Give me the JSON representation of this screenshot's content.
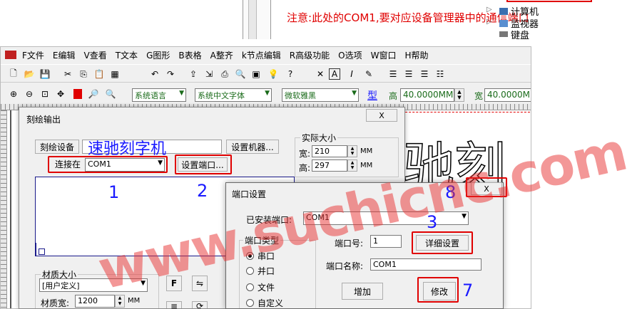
{
  "note": {
    "text": "注意:此处的COM1,要对应设备管理器中的通信端口"
  },
  "device_tree": {
    "items": [
      "计算机",
      "监视器",
      "键盘"
    ]
  },
  "menubar": {
    "items": [
      "F文件",
      "E编辑",
      "V查看",
      "T文本",
      "G图形",
      "B表格",
      "A整齐",
      "k节点编辑",
      "R高级功能",
      "O选项",
      "W窗口",
      "H帮助"
    ]
  },
  "toolbar2": {
    "language": "系统语言",
    "font_set": "系统中文字体",
    "font": "微软雅黑",
    "type_label": "型",
    "height_label": "高",
    "height_value": "40.0000MM",
    "width_label": "宽",
    "width_value": "40.0000MM"
  },
  "engrave_dialog": {
    "title": "刻绘输出",
    "close": "X",
    "device_button": "刻绘设备",
    "device_name": "速驰刻字机",
    "setup_machine_button": "设置机器...",
    "connect_label": "连接在",
    "connect_value": "COM1",
    "setup_port_button": "设置端口...",
    "actual_size_title": "实际大小",
    "width_label": "宽:",
    "width_value": "210",
    "height_label": "高:",
    "height_value": "297",
    "unit": "MM",
    "material_title": "材质大小",
    "material_type": "[用户定义]",
    "material_width_label": "材质宽:",
    "material_width_value": "1200",
    "material_unit": "MM",
    "f_button": "F"
  },
  "port_dialog": {
    "title": "端口设置",
    "close": "X",
    "installed_label": "已安装端口:",
    "installed_value": "COM1",
    "type_group": "端口类型",
    "radio_serial": "串口",
    "radio_parallel": "并口",
    "radio_file": "文件",
    "radio_custom": "自定义",
    "port_no_label": "端口号:",
    "port_no_value": "1",
    "port_name_label": "端口名称:",
    "port_name_value": "COM1",
    "detail_button": "详细设置",
    "add_button": "增加",
    "modify_button": "修改"
  },
  "annotations": {
    "n1": "1",
    "n2": "2",
    "n3": "3",
    "n7": "7",
    "n8": "8"
  },
  "canvas": {
    "text": "驰刻"
  },
  "watermark": {
    "text": "www.suchicnc.com"
  },
  "colors": {
    "accent_red": "#e00000",
    "annotation_blue": "#1a1aff",
    "watermark": "#e83030"
  }
}
